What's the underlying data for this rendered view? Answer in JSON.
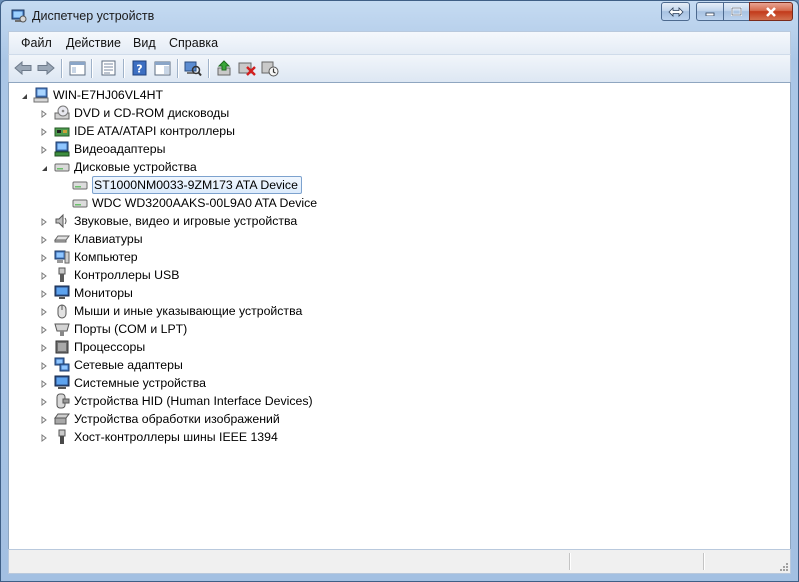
{
  "window": {
    "title": "Диспетчер устройств",
    "app_icon": "device-manager-icon"
  },
  "menu": [
    {
      "label": "Файл"
    },
    {
      "label": "Действие"
    },
    {
      "label": "Вид"
    },
    {
      "label": "Справка"
    }
  ],
  "toolbar": [
    {
      "icon": "back-arrow-icon"
    },
    {
      "icon": "forward-arrow-icon"
    },
    {
      "icon": "show-hide-console-tree-icon"
    },
    {
      "icon": "properties-icon"
    },
    {
      "icon": "help-icon"
    },
    {
      "icon": "action-pane-icon"
    },
    {
      "icon": "scan-hardware-changes-icon"
    },
    {
      "icon": "update-driver-icon"
    },
    {
      "icon": "uninstall-device-icon"
    },
    {
      "icon": "add-legacy-hardware-icon"
    }
  ],
  "tree": {
    "root": {
      "label": "WIN-E7HJ06VL4HT",
      "icon": "computer-icon",
      "expanded": true
    },
    "items": [
      {
        "label": "DVD и CD-ROM дисководы",
        "icon": "dvd-drive-icon",
        "expanded": false
      },
      {
        "label": "IDE ATA/ATAPI контроллеры",
        "icon": "ide-controller-icon",
        "expanded": false
      },
      {
        "label": "Видеоадаптеры",
        "icon": "display-adapter-icon",
        "expanded": false
      },
      {
        "label": "Дисковые устройства",
        "icon": "disk-drive-icon",
        "expanded": true,
        "children": [
          {
            "label": "ST1000NM0033-9ZM173 ATA Device",
            "icon": "hard-disk-icon",
            "selected": true
          },
          {
            "label": "WDC WD3200AAKS-00L9A0 ATA Device",
            "icon": "hard-disk-icon",
            "selected": false
          }
        ]
      },
      {
        "label": "Звуковые, видео и игровые устройства",
        "icon": "speaker-icon",
        "expanded": false
      },
      {
        "label": "Клавиатуры",
        "icon": "keyboard-icon",
        "expanded": false
      },
      {
        "label": "Компьютер",
        "icon": "computer-icon",
        "expanded": false
      },
      {
        "label": "Контроллеры USB",
        "icon": "usb-icon",
        "expanded": false
      },
      {
        "label": "Мониторы",
        "icon": "monitor-icon",
        "expanded": false
      },
      {
        "label": "Мыши и иные указывающие устройства",
        "icon": "mouse-icon",
        "expanded": false
      },
      {
        "label": "Порты (COM и LPT)",
        "icon": "port-icon",
        "expanded": false
      },
      {
        "label": "Процессоры",
        "icon": "processor-icon",
        "expanded": false
      },
      {
        "label": "Сетевые адаптеры",
        "icon": "network-adapter-icon",
        "expanded": false
      },
      {
        "label": "Системные устройства",
        "icon": "system-devices-icon",
        "expanded": false
      },
      {
        "label": "Устройства HID (Human Interface Devices)",
        "icon": "hid-icon",
        "expanded": false
      },
      {
        "label": "Устройства обработки изображений",
        "icon": "imaging-device-icon",
        "expanded": false
      },
      {
        "label": "Хост-контроллеры шины IEEE 1394",
        "icon": "ieee1394-icon",
        "expanded": false
      }
    ]
  },
  "colors": {
    "selection_border": "#7da2ce",
    "selection_fill": "#dcebfc",
    "close_button": "#c2391a",
    "window_frame": "#a3c0e2"
  }
}
